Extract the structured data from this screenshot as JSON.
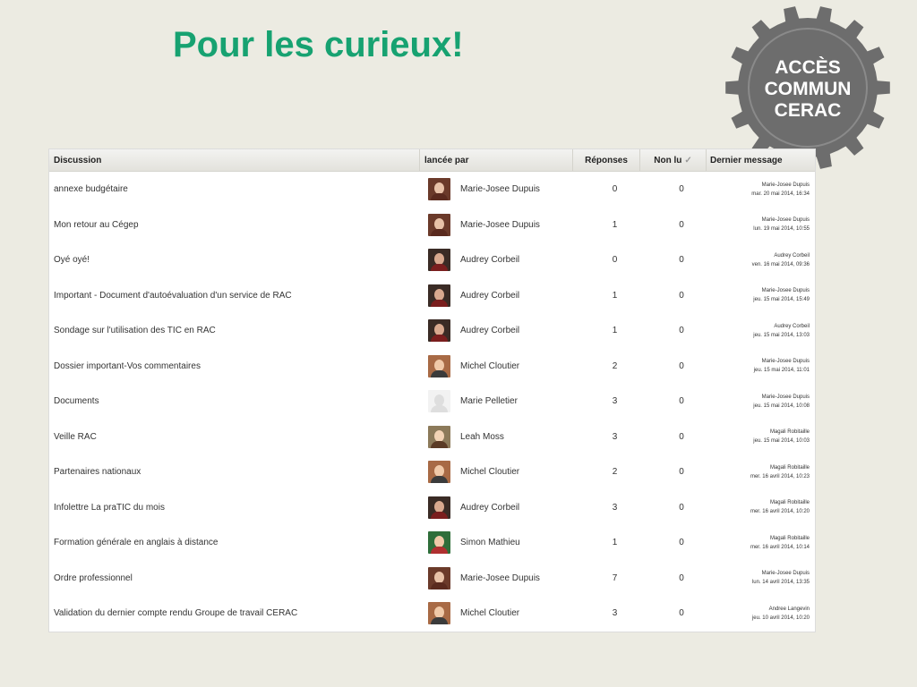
{
  "slide": {
    "title": "Pour les curieux!"
  },
  "badge": {
    "line1": "ACCÈS",
    "line2": "COMMUN",
    "line3": "CERAC"
  },
  "table": {
    "headers": {
      "discussion": "Discussion",
      "started_by": "lancée par",
      "replies": "Réponses",
      "unread": "Non lu",
      "last_message": "Dernier message"
    },
    "rows": [
      {
        "title": "annexe budgétaire",
        "author": "Marie-Josee Dupuis",
        "avatar": "photo-red-hair",
        "replies": "0",
        "unread": "0",
        "last_by": "Marie-Josee Dupuis",
        "last_date": "mar. 20 mai 2014, 16:34"
      },
      {
        "title": "Mon retour au Cégep",
        "author": "Marie-Josee Dupuis",
        "avatar": "photo-red-hair",
        "replies": "1",
        "unread": "0",
        "last_by": "Marie-Josee Dupuis",
        "last_date": "lun. 19 mai 2014, 10:55"
      },
      {
        "title": "Oyé oyé!",
        "author": "Audrey Corbeil",
        "avatar": "photo-dark-hair",
        "replies": "0",
        "unread": "0",
        "last_by": "Audrey Corbeil",
        "last_date": "ven. 16 mai 2014, 09:36"
      },
      {
        "title": "Important - Document d'autoévaluation d'un service de RAC",
        "author": "Audrey Corbeil",
        "avatar": "photo-dark-hair",
        "replies": "1",
        "unread": "0",
        "last_by": "Marie-Josee Dupuis",
        "last_date": "jeu. 15 mai 2014, 15:49"
      },
      {
        "title": "Sondage sur l'utilisation des TIC en RAC",
        "author": "Audrey Corbeil",
        "avatar": "photo-dark-hair",
        "replies": "1",
        "unread": "0",
        "last_by": "Audrey Corbeil",
        "last_date": "jeu. 15 mai 2014, 13:03"
      },
      {
        "title": "Dossier important-Vos commentaires",
        "author": "Michel Cloutier",
        "avatar": "photo-man",
        "replies": "2",
        "unread": "0",
        "last_by": "Marie-Josee Dupuis",
        "last_date": "jeu. 15 mai 2014, 11:01"
      },
      {
        "title": "Documents",
        "author": "Marie Pelletier",
        "avatar": "default-avatar",
        "replies": "3",
        "unread": "0",
        "last_by": "Marie-Josee Dupuis",
        "last_date": "jeu. 15 mai 2014, 10:08"
      },
      {
        "title": "Veille RAC",
        "author": "Leah Moss",
        "avatar": "photo-brown-hair",
        "replies": "3",
        "unread": "0",
        "last_by": "Magali Robitaille",
        "last_date": "jeu. 15 mai 2014, 10:03"
      },
      {
        "title": "Partenaires nationaux",
        "author": "Michel Cloutier",
        "avatar": "photo-man",
        "replies": "2",
        "unread": "0",
        "last_by": "Magali Robitaille",
        "last_date": "mer. 16 avril 2014, 10:23"
      },
      {
        "title": "Infolettre La praTIC du mois",
        "author": "Audrey Corbeil",
        "avatar": "photo-dark-hair",
        "replies": "3",
        "unread": "0",
        "last_by": "Magali Robitaille",
        "last_date": "mer. 16 avril 2014, 10:20"
      },
      {
        "title": "Formation générale en anglais à distance",
        "author": "Simon Mathieu",
        "avatar": "photo-green",
        "replies": "1",
        "unread": "0",
        "last_by": "Magali Robitaille",
        "last_date": "mer. 16 avril 2014, 10:14"
      },
      {
        "title": "Ordre professionnel",
        "author": "Marie-Josee Dupuis",
        "avatar": "photo-red-hair",
        "replies": "7",
        "unread": "0",
        "last_by": "Marie-Josee Dupuis",
        "last_date": "lun. 14 avril 2014, 13:35"
      },
      {
        "title": "Validation du dernier compte rendu Groupe de travail CERAC",
        "author": "Michel Cloutier",
        "avatar": "photo-man",
        "replies": "3",
        "unread": "0",
        "last_by": "Andree Langevin",
        "last_date": "jeu. 10 avril 2014, 10:20"
      }
    ]
  },
  "colors": {
    "title_green": "#17a271",
    "background": "#ecebe2",
    "badge_gray": "#6d6d6d"
  }
}
